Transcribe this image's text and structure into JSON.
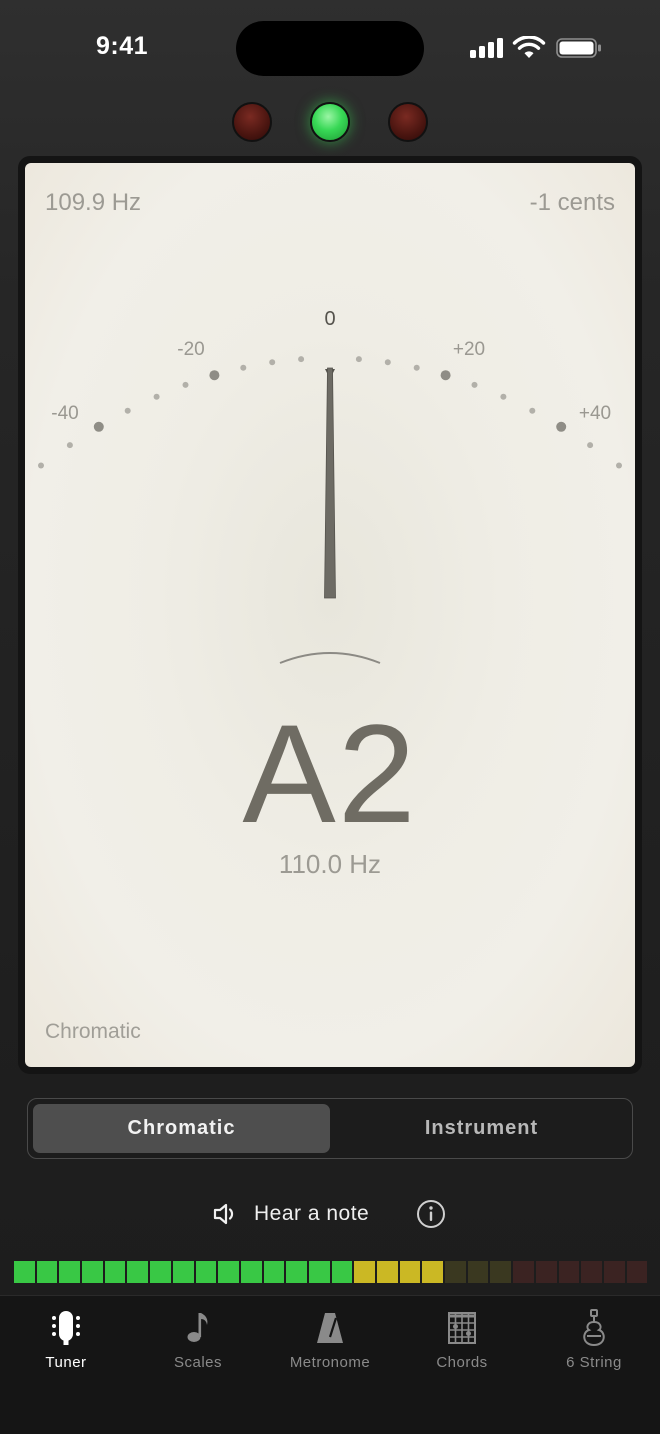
{
  "status_bar": {
    "time": "9:41"
  },
  "indicator_lights": [
    "flat",
    "in-tune",
    "sharp"
  ],
  "meter": {
    "detected_hz": "109.9 Hz",
    "cents_offset": "-1 cents",
    "scale_labels": {
      "zero": "0",
      "minus20": "-20",
      "plus20": "+20",
      "minus40": "-40",
      "plus40": "+40"
    },
    "needle_cents": -1,
    "note_name": "A2",
    "note_reference_hz": "110.0 Hz",
    "mode_label": "Chromatic"
  },
  "mode_selector": {
    "options": [
      "Chromatic",
      "Instrument"
    ],
    "selected": "Chromatic"
  },
  "hear_note": {
    "label": "Hear a note"
  },
  "input_level": {
    "total_segments": 28,
    "lit_green": 15,
    "lit_yellow": 4
  },
  "colors": {
    "green": "#39c845",
    "yellow": "#cbb824",
    "off_yellow": "#3a3820",
    "off_red": "#3b2322",
    "accent_green": "#38d856"
  },
  "tabs": [
    {
      "label": "Tuner",
      "icon": "tuner-icon",
      "active": true
    },
    {
      "label": "Scales",
      "icon": "music-note-icon",
      "active": false
    },
    {
      "label": "Metronome",
      "icon": "metronome-icon",
      "active": false
    },
    {
      "label": "Chords",
      "icon": "chord-grid-icon",
      "active": false
    },
    {
      "label": "6 String",
      "icon": "guitar-icon",
      "active": false
    }
  ]
}
